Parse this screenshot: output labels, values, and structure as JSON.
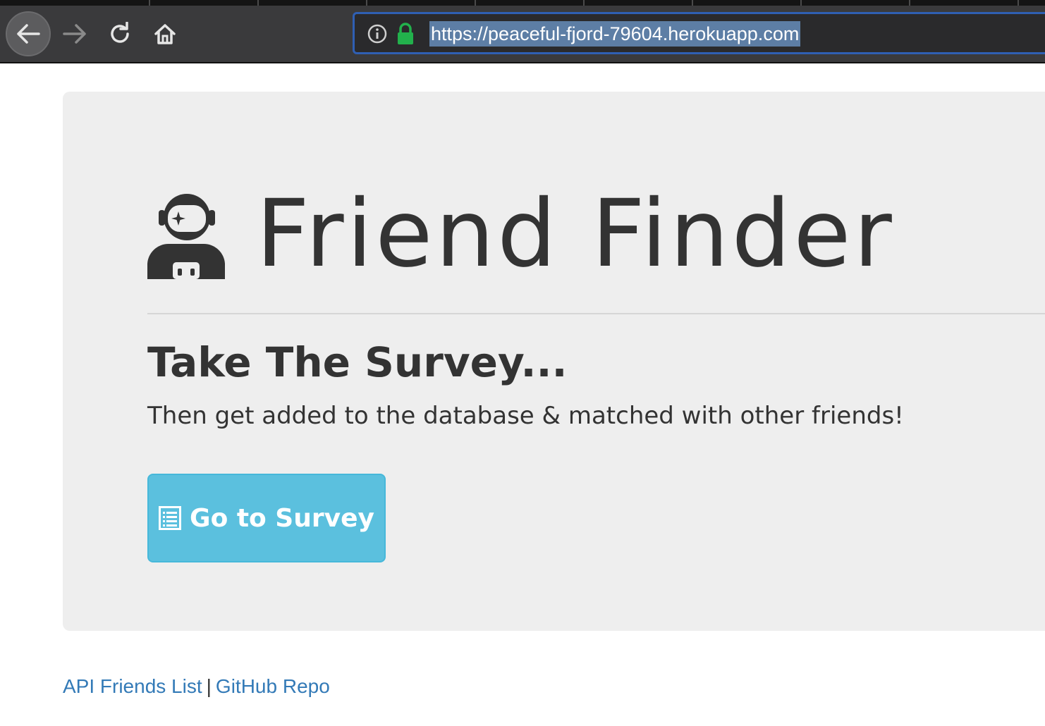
{
  "browser": {
    "url": "https://peaceful-fjord-79604.herokuapp.com"
  },
  "icons": {
    "back": "back-arrow-icon",
    "forward": "forward-arrow-icon",
    "reload": "reload-icon",
    "home": "home-icon",
    "info": "info-icon",
    "lock": "lock-icon",
    "brand": "user-astronaut-icon",
    "survey": "list-alt-icon"
  },
  "colors": {
    "lock": "#22b14c",
    "url_highlight": "#5d7ea5",
    "button": "#5bc0de",
    "link": "#337ab7",
    "jumbotron": "#eeeeee",
    "text": "#333333"
  },
  "page": {
    "title": "Friend Finder",
    "subheading": "Take The Survey...",
    "tagline": "Then get added to the database & matched with other friends!",
    "survey_button_label": "Go to Survey"
  },
  "footer": {
    "api_link": "API Friends List",
    "separator": "|",
    "github_link": "GitHub Repo"
  }
}
